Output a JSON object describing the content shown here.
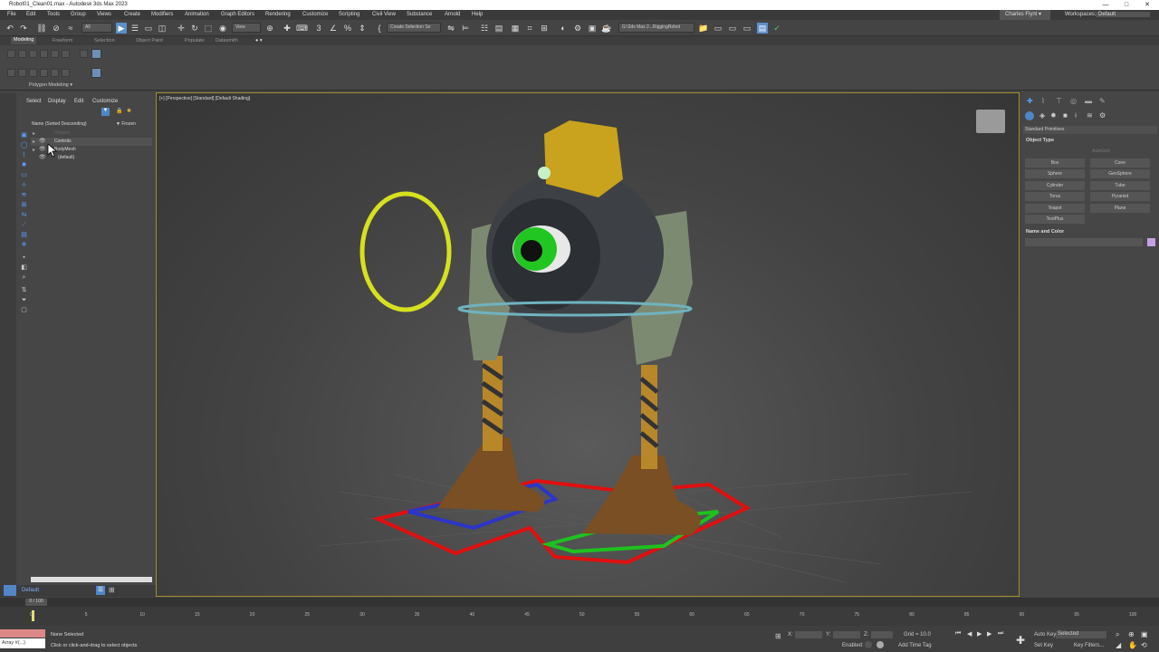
{
  "window": {
    "title": "Robot01_Clean01.max - Autodesk 3ds Max 2023",
    "controls": [
      "—",
      "□",
      "✕"
    ]
  },
  "menu": [
    "File",
    "Edit",
    "Tools",
    "Group",
    "Views",
    "Create",
    "Modifiers",
    "Animation",
    "Graph Editors",
    "Rendering",
    "Customize",
    "Scripting",
    "Civil View",
    "Substance",
    "Arnold",
    "Help"
  ],
  "user": {
    "name": "Charles Flynt ▾",
    "workspace_label": "Workspaces:",
    "workspace": "Default"
  },
  "toolbar": {
    "filter": "All",
    "view": "View",
    "selection_set": "Create Selection Se",
    "path": "G:\\3ds Max 2...RiggingRobot"
  },
  "ribbon": {
    "tabs": [
      "Modeling",
      "Freeform",
      "Selection",
      "Object Paint",
      "Populate",
      "Datasmith"
    ],
    "active": "Modeling",
    "panel_label": "Polygon Modeling ▾"
  },
  "scene_explorer": {
    "menu": [
      "Select",
      "Display",
      "Edit",
      "Customize"
    ],
    "col_name": "Name (Sorted Descending)",
    "col_frozen": "▼ Frozen",
    "items": [
      "Helpers",
      "Controls",
      "BodyMesh",
      "(default)"
    ]
  },
  "layer": "Default",
  "frame_counter": "0 / 100",
  "viewport": {
    "label": "[+] [Perspective] [Standard] [Default Shading]"
  },
  "command_panel": {
    "dropdown": "Standard Primitives",
    "object_type": "Object Type",
    "autogrid": "AutoGrid",
    "buttons": [
      "Box",
      "Cone",
      "Sphere",
      "GeoSphere",
      "Cylinder",
      "Tube",
      "Torus",
      "Pyramid",
      "Teapot",
      "Plane",
      "TextPlus"
    ],
    "name_color": "Name and Color",
    "swatch": "#c6a0e6"
  },
  "timeline": {
    "ticks": [
      "0",
      "5",
      "10",
      "15",
      "20",
      "25",
      "30",
      "35",
      "40",
      "45",
      "50",
      "55",
      "60",
      "65",
      "70",
      "75",
      "80",
      "85",
      "90",
      "95",
      "100"
    ]
  },
  "status": {
    "maxscript": "Array #(...)",
    "selection": "None Selected",
    "prompt": "Click or click-and-drag to select objects",
    "x_label": "X:",
    "y_label": "Y:",
    "z_label": "Z:",
    "grid": "Grid = 10.0",
    "enabled": "Enabled:",
    "add_time_tag": "Add Time Tag",
    "auto_key": "Auto Key",
    "set_key": "Set Key",
    "selected": "Selected",
    "key_filters": "Key Filters..."
  }
}
